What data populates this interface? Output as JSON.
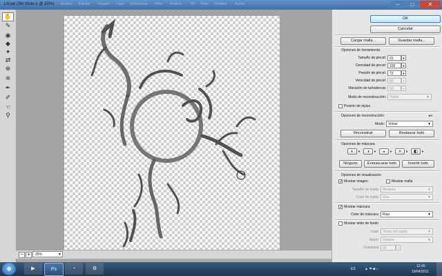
{
  "window": {
    "title": "Licuar (Sin título-1 @ 25%)",
    "background_menu": [
      "Archivo",
      "Edición",
      "Imagen",
      "Capa",
      "Seleccionar",
      "Filtro",
      "Análisis",
      "3D",
      "Vista",
      "Ventana",
      "Ayuda"
    ]
  },
  "zoom": {
    "value": "25%"
  },
  "buttons": {
    "ok": "OK",
    "cancel": "Cancelar",
    "load_mesh": "Cargar malla...",
    "save_mesh": "Guardar malla...",
    "reconstruct": "Reconstruir",
    "restore_all": "Restaurar todo",
    "none": "Ninguno",
    "mask_all": "Enmascarar todo",
    "invert_all": "Invertir todo"
  },
  "tool_options": {
    "heading": "Opciones de herramienta",
    "brush_size": {
      "label": "Tamaño de pincel:",
      "value": "91"
    },
    "brush_density": {
      "label": "Densidad de pincel:",
      "value": "100"
    },
    "brush_pressure": {
      "label": "Presión de pincel:",
      "value": "72"
    },
    "brush_rate": {
      "label": "Velocidad de pincel:",
      "value": "80"
    },
    "turbulent_jitter": {
      "label": "Vibración de turbulencia:",
      "value": "50"
    },
    "reconstruct_mode": {
      "label": "Modo de reconstrucción:",
      "value": "Volver"
    },
    "stylus_pressure": {
      "label": "Presión de stylus",
      "checked": false
    }
  },
  "reconstruct_options": {
    "heading": "Opciones de reconstrucción",
    "mode": {
      "label": "Modo:",
      "value": "Volver"
    }
  },
  "mask_options": {
    "heading": "Opciones de máscara"
  },
  "view_options": {
    "heading": "Opciones de visualización",
    "show_image": {
      "label": "Mostrar imagen",
      "checked": true
    },
    "show_mesh": {
      "label": "Mostrar malla",
      "checked": false
    },
    "mesh_size": {
      "label": "Tamaño de malla:",
      "value": "Mediana"
    },
    "mesh_color": {
      "label": "Color de malla:",
      "value": "Gris"
    },
    "show_mask": {
      "label": "Mostrar máscara",
      "checked": true
    },
    "mask_color": {
      "label": "Color de máscara:",
      "value": "Rojo"
    },
    "show_backdrop": {
      "label": "Mostrar telón de fondo",
      "checked": false
    },
    "use": {
      "label": "Usar:",
      "value": "Todas las capas"
    },
    "backdrop_mode": {
      "label": "Modo:",
      "value": "Delante"
    },
    "opacity": {
      "label": "Opacidad:",
      "value": "50"
    }
  },
  "taskbar": {
    "language": "ES",
    "time": "12:45",
    "date": "19/04/2011",
    "ps_label": "Ps"
  },
  "colors": {
    "title_bar": "#3e6fa6",
    "panel": "#e6e6e6",
    "taskbar": "#1f3550"
  }
}
